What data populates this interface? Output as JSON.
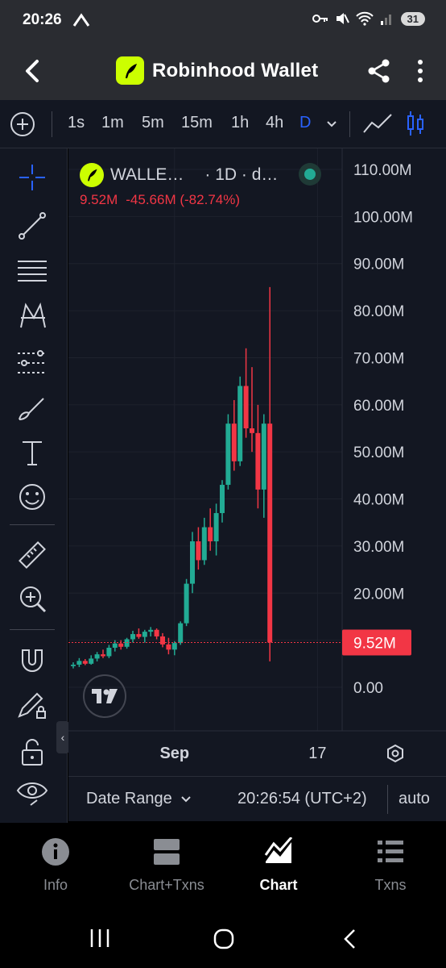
{
  "status": {
    "time": "20:26",
    "battery": "31"
  },
  "appbar": {
    "title": "Robinhood Wallet"
  },
  "toolbar": {
    "intervals": [
      "1s",
      "1m",
      "5m",
      "15m",
      "1h",
      "4h",
      "D"
    ],
    "active_interval": "D"
  },
  "legend": {
    "name": "WALLE…",
    "interval": "· 1D · d…",
    "last": "9.52M",
    "change": "-45.66M",
    "change_pct": "(-82.74%)"
  },
  "chart_data": {
    "type": "candlestick",
    "y_ticks": [
      "110.00M",
      "100.00M",
      "90.00M",
      "80.00M",
      "70.00M",
      "60.00M",
      "50.00M",
      "40.00M",
      "30.00M",
      "20.00M",
      "10.00M",
      "0.00"
    ],
    "y_tick_values": [
      110,
      100,
      90,
      80,
      70,
      60,
      50,
      40,
      30,
      20,
      10,
      0
    ],
    "unit": "M",
    "ylim": [
      -6,
      116
    ],
    "x_ticks": [
      {
        "label": "Sep",
        "index": 17
      },
      {
        "label": "17",
        "index": 41
      }
    ],
    "last_price": 9.52,
    "last_price_label": "9.52M",
    "colors": {
      "up": "#22ab94",
      "down": "#f23645",
      "bg": "#131722",
      "grid": "#1e222d"
    },
    "candles": [
      [
        4.5,
        5.3,
        4.0,
        4.8
      ],
      [
        4.8,
        6.2,
        4.3,
        5.6
      ],
      [
        5.6,
        6.0,
        4.7,
        5.0
      ],
      [
        5.0,
        6.8,
        4.8,
        6.1
      ],
      [
        6.1,
        7.5,
        5.5,
        7.0
      ],
      [
        7.0,
        8.0,
        6.2,
        6.6
      ],
      [
        6.6,
        9.0,
        6.2,
        8.4
      ],
      [
        8.4,
        10.0,
        7.6,
        9.3
      ],
      [
        9.3,
        10.0,
        8.0,
        8.6
      ],
      [
        8.6,
        10.5,
        8.2,
        10.2
      ],
      [
        10.2,
        12.0,
        9.5,
        11.3
      ],
      [
        11.3,
        12.5,
        10.3,
        10.7
      ],
      [
        10.7,
        12.2,
        9.5,
        11.8
      ],
      [
        11.8,
        12.8,
        10.8,
        12.2
      ],
      [
        12.2,
        12.5,
        10.2,
        10.8
      ],
      [
        10.8,
        11.5,
        8.5,
        9.1
      ],
      [
        9.1,
        10.5,
        7.0,
        8.0
      ],
      [
        8.0,
        9.8,
        6.8,
        9.4
      ],
      [
        9.4,
        14.0,
        9.0,
        13.6
      ],
      [
        13.6,
        23.0,
        13.0,
        22.0
      ],
      [
        22.0,
        33.0,
        20.0,
        31.0
      ],
      [
        31.0,
        34.0,
        25.0,
        27.0
      ],
      [
        27.0,
        36.0,
        26.0,
        34.0
      ],
      [
        34.0,
        38.0,
        29.0,
        31.0
      ],
      [
        31.0,
        39.0,
        28.0,
        37.0
      ],
      [
        37.0,
        44.0,
        35.0,
        43.0
      ],
      [
        43.0,
        58.0,
        42.0,
        56.0
      ],
      [
        56.0,
        61.0,
        46.0,
        48.0
      ],
      [
        48.0,
        66.0,
        47.0,
        64.0
      ],
      [
        64.0,
        72.0,
        53.0,
        55.0
      ],
      [
        55.0,
        68.0,
        50.0,
        54.0
      ],
      [
        54.0,
        60.0,
        38.0,
        42.0
      ],
      [
        42.0,
        58.0,
        36.0,
        56.0
      ],
      [
        56.0,
        85.0,
        5.5,
        9.52
      ]
    ]
  },
  "datebar": {
    "range_label": "Date Range",
    "time": "20:26:54 (UTC+2)",
    "auto": "auto"
  },
  "nav": [
    {
      "label": "Info",
      "icon": "info-icon"
    },
    {
      "label": "Chart+Txns",
      "icon": "chart-txns-icon"
    },
    {
      "label": "Chart",
      "icon": "chart-icon",
      "active": true
    },
    {
      "label": "Txns",
      "icon": "list-icon"
    }
  ]
}
